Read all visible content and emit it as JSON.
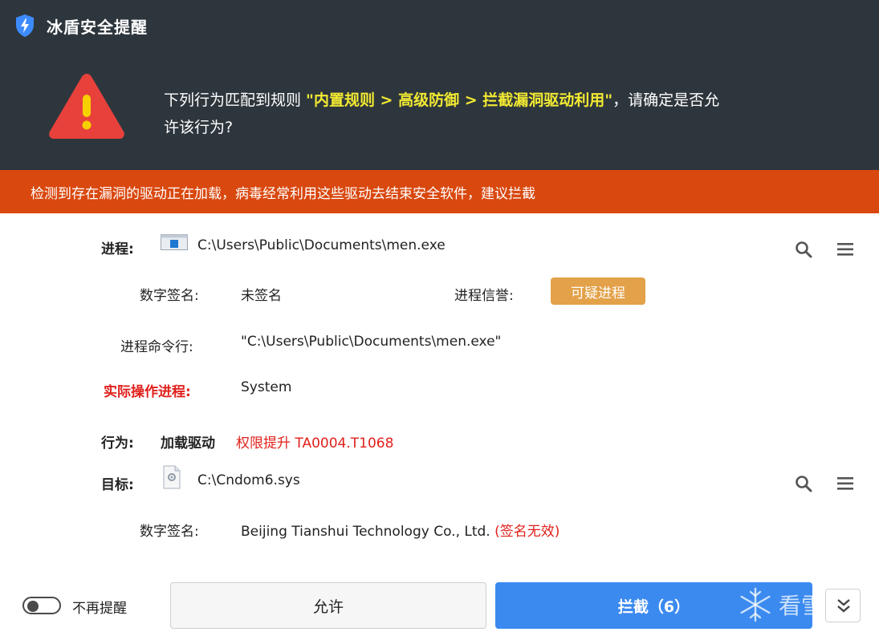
{
  "window": {
    "title": "冰盾安全提醒"
  },
  "alert": {
    "prefix": "下列行为匹配到规则 ",
    "rule": "\"内置规则 > 高级防御 > 拦截漏洞驱动利用\"",
    "suffix_line1": "，请确定是否允",
    "suffix_line2": "许该行为?"
  },
  "banner": {
    "text": "检测到存在漏洞的驱动正在加载，病毒经常利用这些驱动去结束安全软件，建议拦截"
  },
  "process": {
    "label": "进程:",
    "path": "C:\\Users\\Public\\Documents\\men.exe",
    "signature_label": "数字签名:",
    "signature_value": "未签名",
    "reputation_label": "进程信誉:",
    "reputation_value": "可疑进程",
    "cmdline_label": "进程命令行:",
    "cmdline_value": "\"C:\\Users\\Public\\Documents\\men.exe\"",
    "actual_label": "实际操作进程:",
    "actual_value": "System"
  },
  "behavior": {
    "label": "行为:",
    "action": "加载驱动",
    "tag": "权限提升 TA0004.T1068"
  },
  "target": {
    "label": "目标:",
    "path": "C:\\Cndom6.sys",
    "signature_label": "数字签名:",
    "signer": "Beijing Tianshui Technology Co., Ltd.",
    "signature_status": "(签名无效)"
  },
  "footer": {
    "toggle_label": "不再提醒",
    "allow_label": "允许",
    "block_label": "拦截（6）",
    "watermark_text": "看雪"
  },
  "icons": {
    "app": "shield-lightning-icon",
    "warning": "warning-triangle-icon",
    "search": "search-icon",
    "menu": "menu-icon",
    "expand": "chevron-double-down-icon"
  },
  "colors": {
    "header_bg": "#2e363d",
    "banner_bg": "#d9480f",
    "rule_text": "#f2ea32",
    "warning_red": "#e0201b",
    "badge_bg": "#e3a149",
    "primary_button": "#3b8af0"
  }
}
